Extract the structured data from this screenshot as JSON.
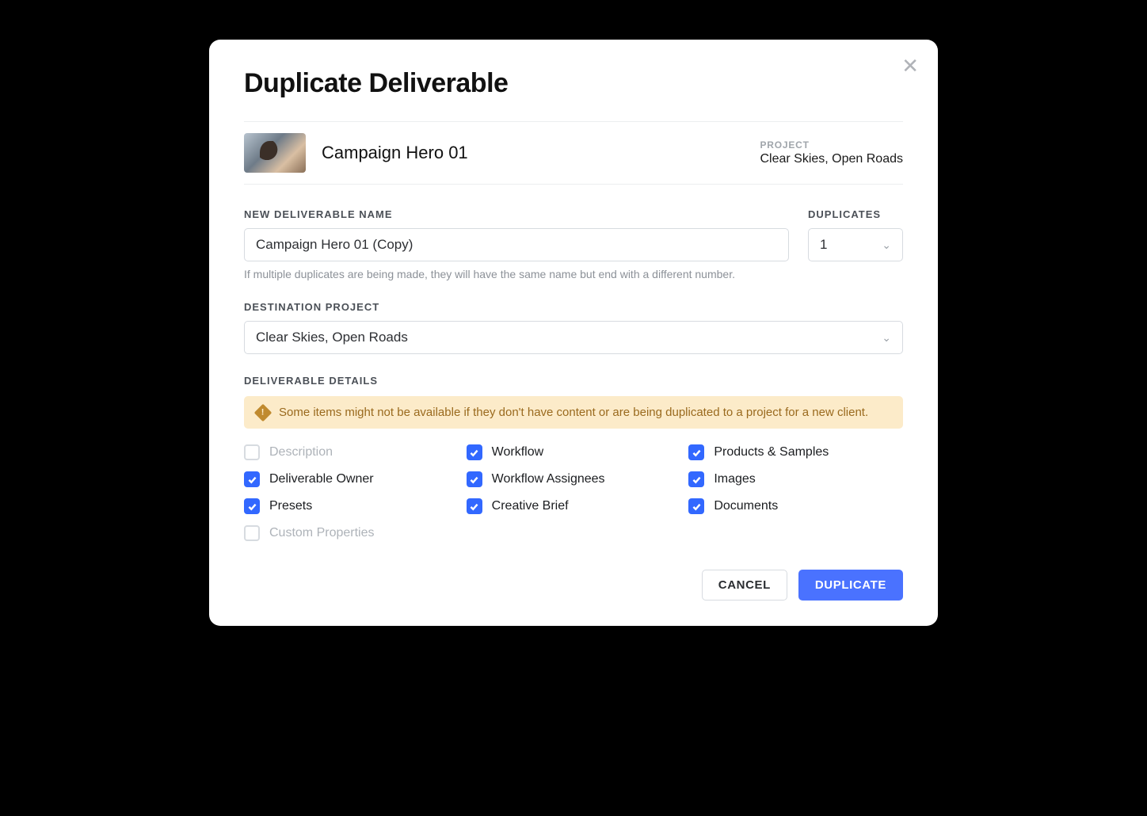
{
  "modal": {
    "title": "Duplicate Deliverable",
    "source": {
      "name": "Campaign Hero 01",
      "project_label": "PROJECT",
      "project_name": "Clear Skies, Open Roads"
    },
    "name_field": {
      "label": "NEW DELIVERABLE NAME",
      "value": "Campaign Hero 01 (Copy)"
    },
    "duplicates_field": {
      "label": "DUPLICATES",
      "value": "1"
    },
    "help_text": "If multiple duplicates are being made, they will have the same name but end with a different number.",
    "destination": {
      "label": "DESTINATION PROJECT",
      "value": "Clear Skies, Open Roads"
    },
    "details": {
      "label": "DELIVERABLE DETAILS",
      "warning": "Some items might not be available if they don't have content or are being duplicated to a project for a new client.",
      "items": [
        {
          "label": "Description",
          "checked": false,
          "disabled": true
        },
        {
          "label": "Workflow",
          "checked": true,
          "disabled": false
        },
        {
          "label": "Products & Samples",
          "checked": true,
          "disabled": false
        },
        {
          "label": "Deliverable Owner",
          "checked": true,
          "disabled": false
        },
        {
          "label": "Workflow Assignees",
          "checked": true,
          "disabled": false
        },
        {
          "label": "Images",
          "checked": true,
          "disabled": false
        },
        {
          "label": "Presets",
          "checked": true,
          "disabled": false
        },
        {
          "label": "Creative Brief",
          "checked": true,
          "disabled": false
        },
        {
          "label": "Documents",
          "checked": true,
          "disabled": false
        },
        {
          "label": "Custom Properties",
          "checked": false,
          "disabled": true
        }
      ]
    },
    "actions": {
      "cancel": "CANCEL",
      "confirm": "DUPLICATE"
    }
  }
}
